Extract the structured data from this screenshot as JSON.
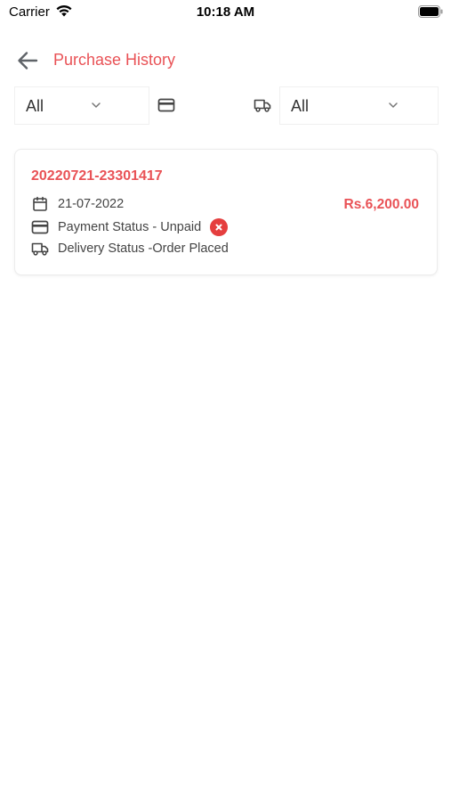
{
  "status_bar": {
    "carrier": "Carrier",
    "time": "10:18 AM"
  },
  "header": {
    "title": "Purchase History",
    "back_icon": "arrow-left-icon"
  },
  "filters": {
    "payment_filter_value": "All",
    "payment_icon": "credit-card-icon",
    "delivery_icon": "truck-icon",
    "delivery_filter_value": "All"
  },
  "orders": [
    {
      "code": "20220721-23301417",
      "date": "21-07-2022",
      "amount": "Rs.6,200.00",
      "payment_status": "Payment Status - Unpaid",
      "delivery_status": "Delivery Status -Order Placed"
    }
  ],
  "colors": {
    "accent": "#e95256",
    "unpaid": "#e53e3e"
  }
}
